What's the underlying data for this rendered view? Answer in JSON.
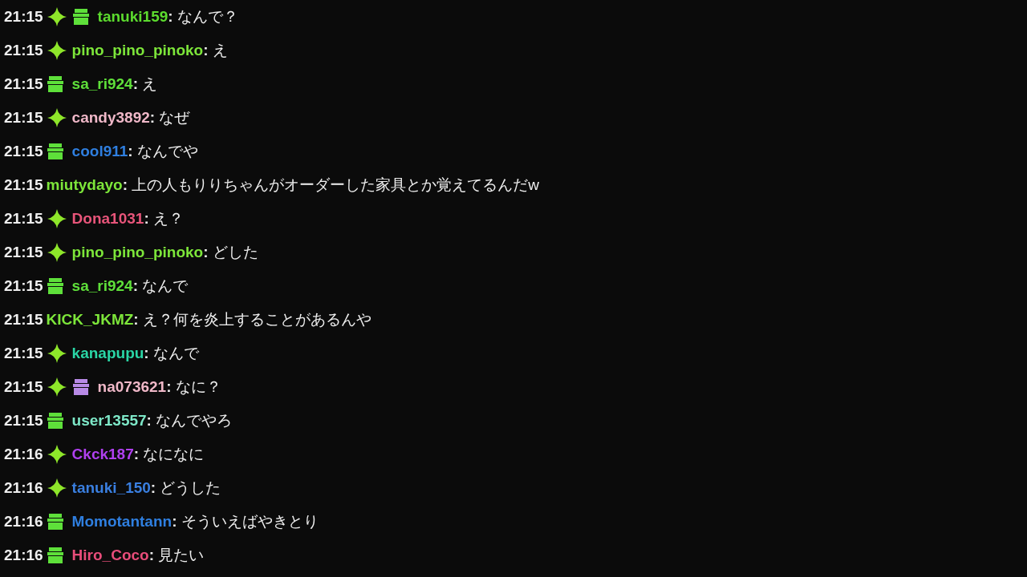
{
  "messages": [
    {
      "time": "21:15",
      "badges": [
        {
          "kind": "sparkle"
        },
        {
          "kind": "gift",
          "color": "#5ee03a"
        }
      ],
      "user": "tanuki159",
      "color": "#5cdb2e",
      "separator": ":",
      "text": "なんで？"
    },
    {
      "time": "21:15",
      "badges": [
        {
          "kind": "sparkle"
        }
      ],
      "user": "pino_pino_pinoko",
      "color": "#7de63a",
      "separator": ":",
      "text": "え"
    },
    {
      "time": "21:15",
      "badges": [
        {
          "kind": "gift",
          "color": "#5ee03a"
        }
      ],
      "user": "sa_ri924",
      "color": "#5fe03a",
      "separator": ":",
      "text": "え"
    },
    {
      "time": "21:15",
      "badges": [
        {
          "kind": "sparkle"
        }
      ],
      "user": "candy3892",
      "color": "#f0b8c8",
      "separator": ":",
      "text": "なぜ"
    },
    {
      "time": "21:15",
      "badges": [
        {
          "kind": "gift",
          "color": "#5ee03a"
        }
      ],
      "user": "cool911",
      "color": "#2f7fe0",
      "separator": ":",
      "text": "なんでや"
    },
    {
      "time": "21:15",
      "user": "miutydayo",
      "color": "#7de63a",
      "separator": ":",
      "text": "上の人もりりちゃんがオーダーした家具とか覚えてるんだw"
    },
    {
      "time": "21:15",
      "badges": [
        {
          "kind": "sparkle"
        }
      ],
      "user": "Dona1031",
      "color": "#e8557a",
      "separator": ":",
      "text": "え？"
    },
    {
      "time": "21:15",
      "badges": [
        {
          "kind": "sparkle"
        }
      ],
      "user": "pino_pino_pinoko",
      "color": "#7de63a",
      "separator": ":",
      "text": "どした"
    },
    {
      "time": "21:15",
      "badges": [
        {
          "kind": "gift",
          "color": "#5ee03a"
        }
      ],
      "user": "sa_ri924",
      "color": "#5fe03a",
      "separator": ":",
      "text": "なんで"
    },
    {
      "time": "21:15",
      "user": "KICK_JKMZ",
      "color": "#7de63a",
      "separator": ":",
      "text": "え？何を炎上することがあるんや"
    },
    {
      "time": "21:15",
      "badges": [
        {
          "kind": "sparkle"
        }
      ],
      "user": "kanapupu",
      "color": "#2ad6a6",
      "separator": ":",
      "text": "なんで"
    },
    {
      "time": "21:15",
      "badges": [
        {
          "kind": "sparkle"
        },
        {
          "kind": "gift",
          "color": "#b88ae6"
        }
      ],
      "user": "na073621",
      "color": "#f0b8c8",
      "separator": ":",
      "text": "なに？"
    },
    {
      "time": "21:15",
      "badges": [
        {
          "kind": "gift",
          "color": "#5ee03a"
        }
      ],
      "user": "user13557",
      "color": "#7ee8c8",
      "separator": ":",
      "text": "なんでやろ"
    },
    {
      "time": "21:16",
      "badges": [
        {
          "kind": "sparkle"
        }
      ],
      "user": "Ckck187",
      "color": "#b040f0",
      "separator": ":",
      "text": "なになに"
    },
    {
      "time": "21:16",
      "badges": [
        {
          "kind": "sparkle"
        }
      ],
      "user": "tanuki_150",
      "color": "#3a7fe0",
      "separator": ":",
      "text": "どうした"
    },
    {
      "time": "21:16",
      "badges": [
        {
          "kind": "gift",
          "color": "#5ee03a"
        }
      ],
      "user": "Momotantann",
      "color": "#2f7fe0",
      "separator": ":",
      "text": "そういえばやきとり"
    },
    {
      "time": "21:16",
      "badges": [
        {
          "kind": "gift",
          "color": "#5ee03a"
        }
      ],
      "user": "Hiro_Coco",
      "color": "#e84d7a",
      "separator": ":",
      "text": "見たい"
    }
  ]
}
